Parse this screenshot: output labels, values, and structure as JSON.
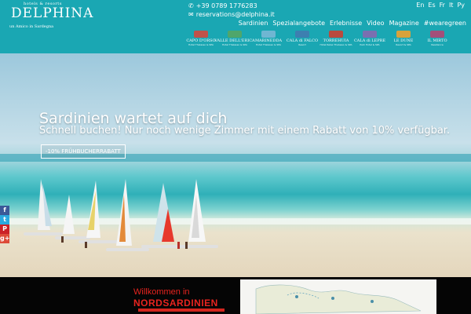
{
  "brand": {
    "top": "hotels & resorts",
    "name": "DELPHINA",
    "tagline": "un Amico in Sardegna"
  },
  "contact": {
    "phone": "+39 0789 1776283",
    "email": "reservations@delphina.it"
  },
  "languages": [
    "En",
    "Es",
    "Fr",
    "It",
    "Ру"
  ],
  "nav": [
    "Sardinien",
    "Spezialangebote",
    "Erlebnisse",
    "Video",
    "Magazine",
    "#wearegreen"
  ],
  "hotels": [
    {
      "name": "CAPO D'ORSO",
      "stars": "Hotel Thalasso & SPA"
    },
    {
      "name": "VALLE DELL'ERICA",
      "stars": "Hotel Thalasso & SPA"
    },
    {
      "name": "MARINEDDA",
      "stars": "Hotel Thalasso & SPA"
    },
    {
      "name": "CALA di FALCO",
      "stars": "Resort"
    },
    {
      "name": "TORREHUIA",
      "stars": "Hotel Relax Thalasso & SPA"
    },
    {
      "name": "CALA di LEPRE",
      "stars": "Park Hotel & SPA"
    },
    {
      "name": "LE DUNE",
      "stars": "Resort & SPA"
    },
    {
      "name": "IL MIRTO",
      "stars": "Residence"
    }
  ],
  "hero": {
    "title": "Sardinien wartet auf dich",
    "subtitle": "Schnell buchen! Nur noch wenige Zimmer mit einem Rabatt von 10% verfügbar.",
    "button": "-10% FRÜHBUCHERRABATT"
  },
  "social": [
    "f",
    "t",
    "P",
    "g+"
  ],
  "welcome": {
    "line1": "Willkommen in",
    "line2": "NORDSARDINIEN"
  },
  "colors": {
    "header": "#1aa7b3",
    "accent_red": "#e8241f"
  }
}
